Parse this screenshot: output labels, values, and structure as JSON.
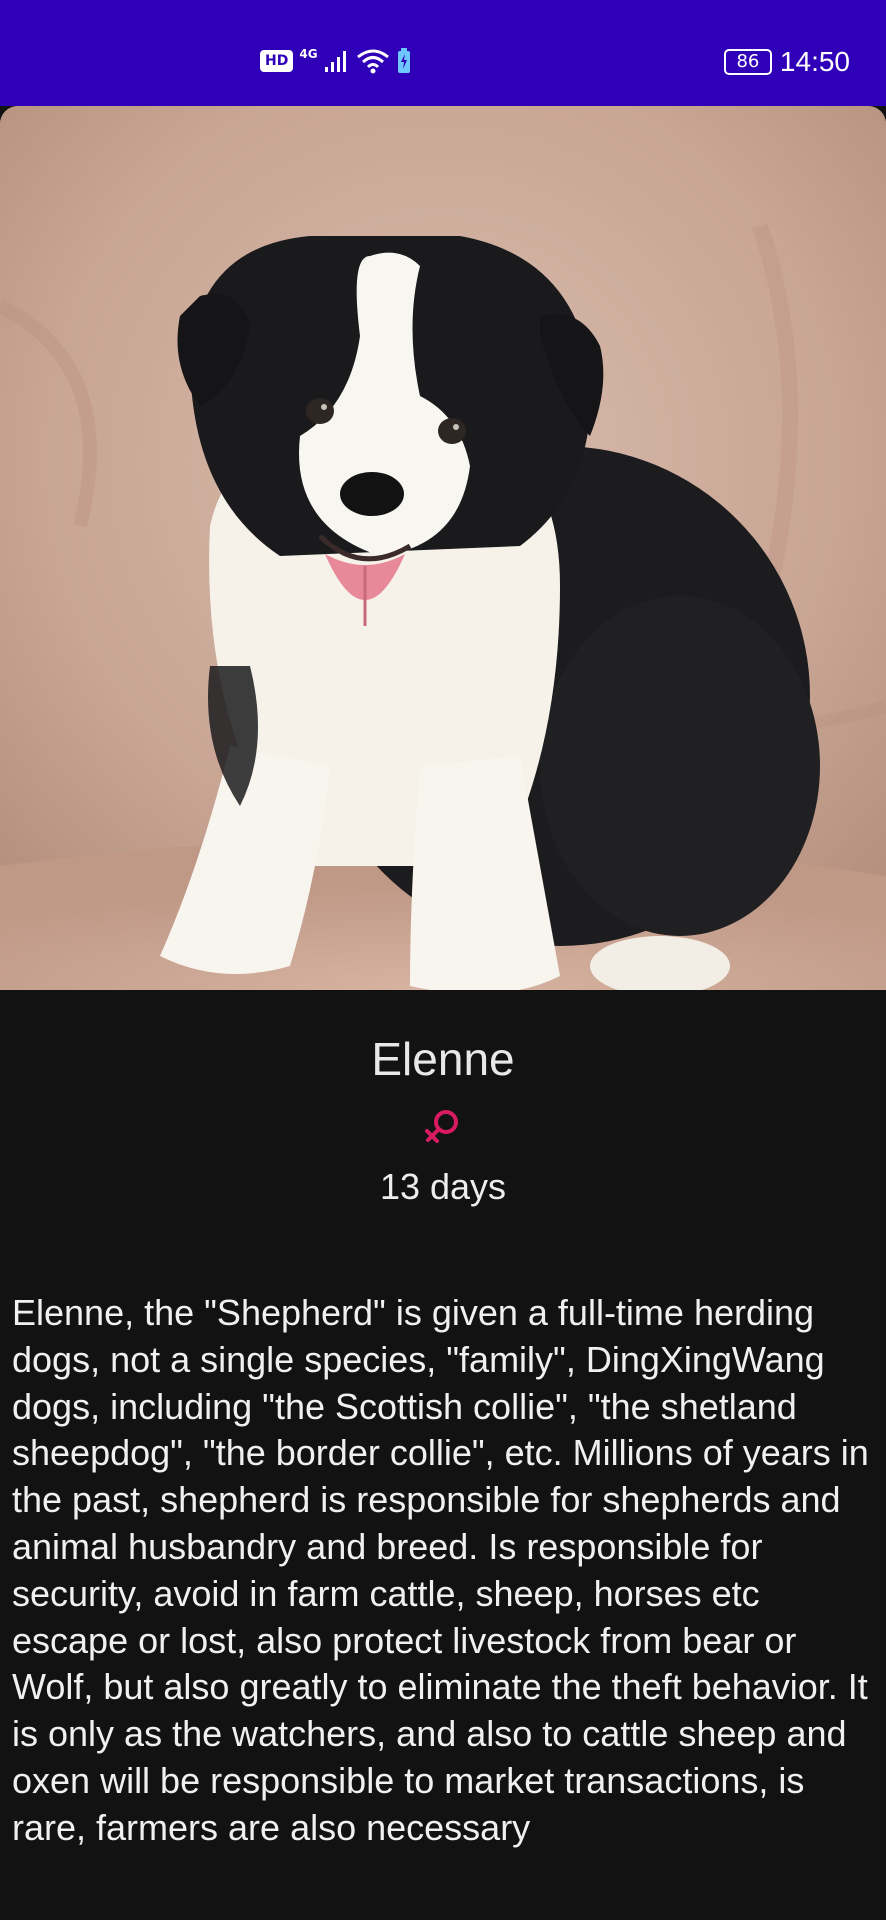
{
  "status_bar": {
    "hd_badge": "HD",
    "network": "4G",
    "battery_level": "86",
    "time": "14:50",
    "background_color": "#2f00b8",
    "icons": [
      "signal-icon",
      "wifi-icon",
      "battery-saver-icon",
      "battery-icon"
    ]
  },
  "hero": {
    "image_subject": "black-and-white border collie puppy sitting",
    "background_color": "#c9a99a"
  },
  "pet": {
    "name": "Elenne",
    "gender_icon": "female-icon",
    "gender_color": "#d81b60",
    "age": "13 days",
    "description": "Elenne, the \"Shepherd\" is given a full-time herding dogs, not a single species, \"family\", DingXingWang dogs, including \"the Scottish collie\", \"the shetland sheepdog\", \"the border collie\", etc. Millions of years in the past, shepherd is responsible for shepherds and animal husbandry and breed. Is responsible for security, avoid in farm cattle, sheep, horses etc escape or lost, also protect livestock from bear or Wolf, but also greatly to eliminate the theft behavior. It is only as the watchers, and also to cattle sheep and oxen will be responsible to market transactions, is rare, farmers are also necessary"
  }
}
